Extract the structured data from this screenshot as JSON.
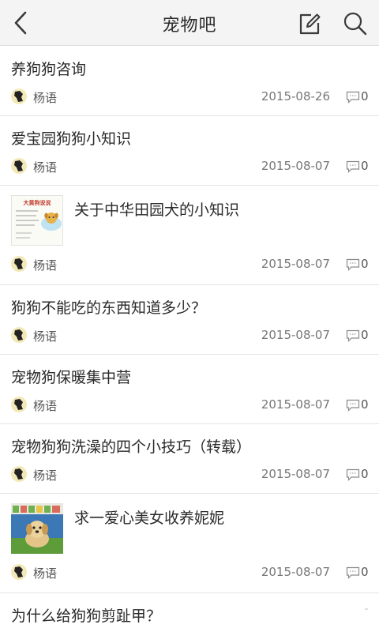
{
  "header": {
    "title": "宠物吧",
    "back_icon": "chevron-left-icon",
    "compose_icon": "compose-icon",
    "search_icon": "search-icon"
  },
  "posts": [
    {
      "title": "养狗狗咨询",
      "author": "杨语",
      "date": "2015-08-26",
      "comments": "0",
      "has_thumb": false
    },
    {
      "title": "爱宝园狗狗小知识",
      "author": "杨语",
      "date": "2015-08-07",
      "comments": "0",
      "has_thumb": false
    },
    {
      "title": "关于中华田园犬的小知识",
      "author": "杨语",
      "date": "2015-08-07",
      "comments": "0",
      "has_thumb": true,
      "thumb_heading": "大黄狗说说"
    },
    {
      "title": "狗狗不能吃的东西知道多少？",
      "author": "杨语",
      "date": "2015-08-07",
      "comments": "0",
      "has_thumb": false
    },
    {
      "title": "宠物狗保暖集中营",
      "author": "杨语",
      "date": "2015-08-07",
      "comments": "0",
      "has_thumb": false
    },
    {
      "title": "宠物狗狗洗澡的四个小技巧（转载）",
      "author": "杨语",
      "date": "2015-08-07",
      "comments": "0",
      "has_thumb": false
    },
    {
      "title": "求一爱心美女收养妮妮",
      "author": "杨语",
      "date": "2015-08-07",
      "comments": "0",
      "has_thumb": true
    },
    {
      "title": "为什么给狗狗剪趾甲？",
      "partial": true
    }
  ]
}
